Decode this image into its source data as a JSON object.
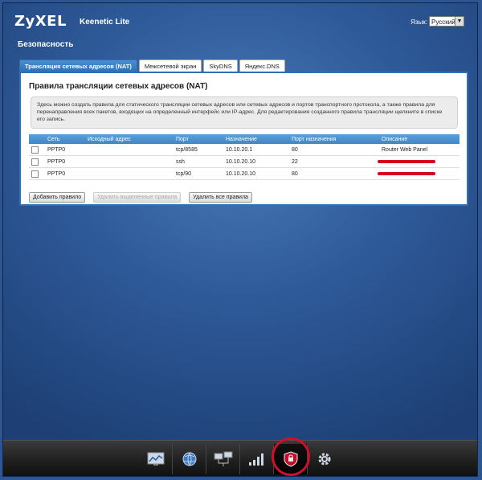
{
  "header": {
    "logo": "ZyXEL",
    "product": "Keenetic Lite",
    "language_label": "Язык:",
    "language_value": "Русский"
  },
  "page_title": "Безопасность",
  "tabs": [
    {
      "label": "Трансляция сетевых адресов (NAT)",
      "active": true
    },
    {
      "label": "Межсетевой экран",
      "active": false
    },
    {
      "label": "SkyDNS",
      "active": false
    },
    {
      "label": "Яндекс.DNS",
      "active": false
    }
  ],
  "panel": {
    "title": "Правила трансляции сетевых адресов (NAT)",
    "info": "Здесь можно создать правила для статического трансляции сетевых адресов или сетевых адресов и портов транспортного протокола, а также правила для перенаправления всех пакетов, входящих на определенный интерфейс или IP-адрес. Для редактирования созданного правила трансляции щелкните в списке его запись."
  },
  "table": {
    "columns": [
      "Сеть",
      "Исходный адрес",
      "Порт",
      "Назначение",
      "Порт назначения",
      "Описание"
    ],
    "rows": [
      {
        "net": "PPTP0",
        "src": "",
        "port": "tcp/8585",
        "dest": "10.10.20.1",
        "dport": "80",
        "desc": "Router Web Panel",
        "redacted": false
      },
      {
        "net": "PPTP0",
        "src": "",
        "port": "ssh",
        "dest": "10.10.20.10",
        "dport": "22",
        "desc": "",
        "redacted": true
      },
      {
        "net": "PPTP0",
        "src": "",
        "port": "tcp/90",
        "dest": "10.10.20.10",
        "dport": "80",
        "desc": "",
        "redacted": true
      }
    ]
  },
  "buttons": {
    "add": "Добавить правило",
    "delete_selected": "Удалить выделенные правила",
    "delete_all": "Удалить все правила"
  },
  "bottom_icons": [
    "monitor-chart-icon",
    "globe-icon",
    "network-computers-icon",
    "signal-bars-icon",
    "shield-icon",
    "gear-icon"
  ],
  "colors": {
    "accent": "#2f6fb5",
    "highlight": "#d0102a"
  }
}
